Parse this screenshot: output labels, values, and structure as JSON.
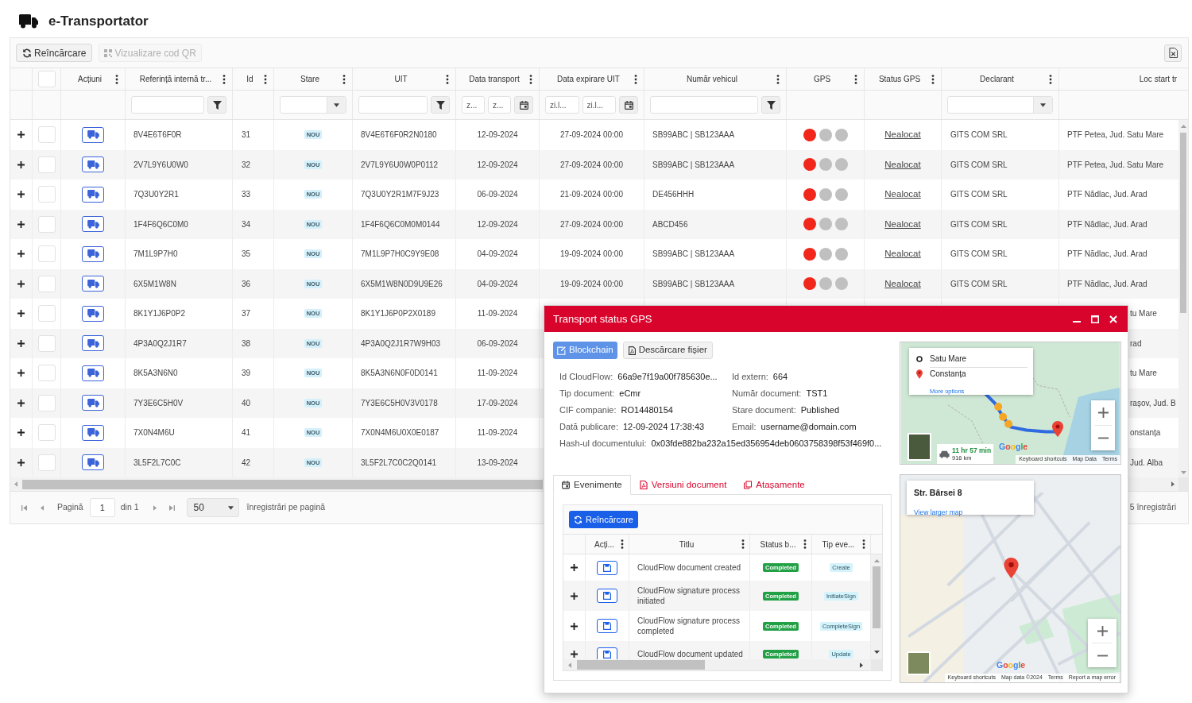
{
  "app": {
    "title": "e-Transportator"
  },
  "toolbar": {
    "buttons": [
      {
        "label": "Reîncărcare",
        "kind": "reload",
        "disabled": false
      },
      {
        "label": "Vizualizare cod QR",
        "kind": "qr",
        "disabled": true
      }
    ]
  },
  "table": {
    "select_all_checked": false,
    "columns": [
      {
        "label": "Acțiuni",
        "menu": true
      },
      {
        "label": "Referință internă tr...",
        "menu": true,
        "filter": {
          "kind": "text"
        }
      },
      {
        "label": "Id",
        "menu": true
      },
      {
        "label": "Stare",
        "menu": true,
        "filter": {
          "kind": "select"
        }
      },
      {
        "label": "UIT",
        "menu": true,
        "filter": {
          "kind": "text"
        }
      },
      {
        "label": "Data transport",
        "menu": true,
        "filter": {
          "kind": "date_range",
          "placeholders": [
            "z...",
            "z..."
          ]
        }
      },
      {
        "label": "Data expirare UIT",
        "menu": true,
        "filter": {
          "kind": "date_range",
          "placeholders": [
            "zi.l...",
            "zi.l..."
          ]
        }
      },
      {
        "label": "Număr vehicul",
        "menu": true,
        "filter": {
          "kind": "text"
        }
      },
      {
        "label": "GPS",
        "menu": true
      },
      {
        "label": "Status GPS",
        "menu": true
      },
      {
        "label": "Declarant",
        "menu": true,
        "filter": {
          "kind": "select"
        }
      },
      {
        "label": "Loc start tr",
        "menu": false
      }
    ],
    "rows": [
      {
        "checked": false,
        "ref": "8V4E6T6F0R",
        "id": "31",
        "stare": "NOU",
        "uit": "8V4E6T6F0R2N0180",
        "data_transport": "12-09-2024",
        "data_expirare": "27-09-2024 00:00",
        "numar_vehicul": "SB99ABC | SB123AAA",
        "gps": [
          {
            "color": "#f2271c"
          },
          {
            "color": "#c0c0c0"
          },
          {
            "color": "#c0c0c0"
          }
        ],
        "status_gps": "Nealocat",
        "declarant": "GITS COM SRL",
        "loc_start": "PTF Petea, Jud. Satu Mare"
      },
      {
        "checked": false,
        "ref": "2V7L9Y6U0W0",
        "id": "32",
        "stare": "NOU",
        "uit": "2V7L9Y6U0W0P0112",
        "data_transport": "12-09-2024",
        "data_expirare": "27-09-2024 00:00",
        "numar_vehicul": "SB99ABC | SB123AAA",
        "gps": [
          {
            "color": "#f2271c"
          },
          {
            "color": "#c0c0c0"
          },
          {
            "color": "#c0c0c0"
          }
        ],
        "status_gps": "Nealocat",
        "declarant": "GITS COM SRL",
        "loc_start": "PTF Petea, Jud. Satu Mare"
      },
      {
        "checked": false,
        "ref": "7Q3U0Y2R1",
        "id": "33",
        "stare": "NOU",
        "uit": "7Q3U0Y2R1M7F9J23",
        "data_transport": "06-09-2024",
        "data_expirare": "21-09-2024 00:00",
        "numar_vehicul": "DE456HHH",
        "gps": [
          {
            "color": "#f2271c"
          },
          {
            "color": "#c0c0c0"
          },
          {
            "color": "#c0c0c0"
          }
        ],
        "status_gps": "Nealocat",
        "declarant": "GITS COM SRL",
        "loc_start": "PTF Nădlac, Jud. Arad"
      },
      {
        "checked": false,
        "ref": "1F4F6Q6C0M0",
        "id": "34",
        "stare": "NOU",
        "uit": "1F4F6Q6C0M0M0144",
        "data_transport": "12-09-2024",
        "data_expirare": "27-09-2024 00:00",
        "numar_vehicul": "ABCD456",
        "gps": [
          {
            "color": "#f2271c"
          },
          {
            "color": "#c0c0c0"
          },
          {
            "color": "#c0c0c0"
          }
        ],
        "status_gps": "Nealocat",
        "declarant": "GITS COM SRL",
        "loc_start": "PTF Nădlac, Jud. Arad"
      },
      {
        "checked": false,
        "ref": "7M1L9P7H0",
        "id": "35",
        "stare": "NOU",
        "uit": "7M1L9P7H0C9Y9E08",
        "data_transport": "04-09-2024",
        "data_expirare": "19-09-2024 00:00",
        "numar_vehicul": "SB99ABC | SB123AAA",
        "gps": [
          {
            "color": "#f2271c"
          },
          {
            "color": "#c0c0c0"
          },
          {
            "color": "#c0c0c0"
          }
        ],
        "status_gps": "Nealocat",
        "declarant": "GITS COM SRL",
        "loc_start": "PTF Nădlac, Jud. Arad"
      },
      {
        "checked": false,
        "ref": "6X5M1W8N",
        "id": "36",
        "stare": "NOU",
        "uit": "6X5M1W8N0D9U9E26",
        "data_transport": "04-09-2024",
        "data_expirare": "19-09-2024 00:00",
        "numar_vehicul": "SB99ABC | SB123AAA",
        "gps": [
          {
            "color": "#f2271c"
          },
          {
            "color": "#c0c0c0"
          },
          {
            "color": "#c0c0c0"
          }
        ],
        "status_gps": "Nealocat",
        "declarant": "GITS COM SRL",
        "loc_start": "PTF Nădlac, Jud. Arad"
      },
      {
        "checked": false,
        "ref": "8K1Y1J6P0P2",
        "id": "37",
        "stare": "NOU",
        "uit": "8K1Y1J6P0P2X0189",
        "data_transport": "11-09-2024",
        "loc_start": "tu Mare"
      },
      {
        "checked": false,
        "ref": "4P3A0Q2J1R7",
        "id": "38",
        "stare": "NOU",
        "uit": "4P3A0Q2J1R7W9H03",
        "data_transport": "06-09-2024",
        "loc_start": "rad"
      },
      {
        "checked": false,
        "ref": "8K5A3N6N0",
        "id": "39",
        "stare": "NOU",
        "uit": "8K5A3N6N0F0D0141",
        "data_transport": "11-09-2024",
        "loc_start": "tu Mare"
      },
      {
        "checked": false,
        "ref": "7Y3E6C5H0V",
        "id": "40",
        "stare": "NOU",
        "uit": "7Y3E6C5H0V3V0178",
        "data_transport": "17-09-2024",
        "loc_start": "rașov, Jud. B"
      },
      {
        "checked": false,
        "ref": "7X0N4M6U",
        "id": "41",
        "stare": "NOU",
        "uit": "7X0N4M6U0X0E0187",
        "data_transport": "11-09-2024",
        "loc_start": "onstanța"
      },
      {
        "checked": false,
        "ref": "3L5F2L7C0C",
        "id": "42",
        "stare": "NOU",
        "uit": "3L5F2L7C0C2Q0141",
        "data_transport": "13-09-2024",
        "loc_start": "Jud. Alba"
      }
    ]
  },
  "pager": {
    "page_label": "Pagină",
    "page": "1",
    "of_label": "din 1",
    "page_size": "50",
    "page_size_label": "înregistrări pe pagină",
    "summary": "5 înregistrări"
  },
  "dialog": {
    "title": "Transport status GPS",
    "buttons": [
      {
        "label": "Blockchain",
        "kind": "primary"
      },
      {
        "label": "Descărcare fișier",
        "kind": "default"
      }
    ],
    "details": [
      [
        {
          "label": "Id CloudFlow:",
          "value": "66a9e7f19a00f785630e..."
        },
        {
          "label": "Id extern:",
          "value": "664"
        }
      ],
      [
        {
          "label": "Tip document:",
          "value": "eCmr"
        },
        {
          "label": "Număr document:",
          "value": "TST1"
        }
      ],
      [
        {
          "label": "CIF companie:",
          "value": "RO14480154"
        },
        {
          "label": "Stare document:",
          "value": "Published"
        }
      ],
      [
        {
          "label": "Dată publicare:",
          "value": "12-09-2024 17:38:43"
        },
        {
          "label": "Email:",
          "value": "username@domain.com"
        }
      ],
      [
        {
          "label": "Hash-ul documentului:",
          "value": "0x03fde882ba232a15ed356954deb0603758398f53f469f0..."
        }
      ]
    ],
    "tabs": [
      {
        "label": "Evenimente",
        "selected": true
      },
      {
        "label": "Versiuni document",
        "selected": false
      },
      {
        "label": "Atașamente",
        "selected": false
      }
    ],
    "events": {
      "reload_label": "Reîncărcare",
      "columns": [
        {
          "label": "Acți..."
        },
        {
          "label": "Titlu"
        },
        {
          "label": "Status b..."
        },
        {
          "label": "Tip eve..."
        }
      ],
      "rows": [
        {
          "title": "CloudFlow document created",
          "status": "Completed",
          "type": "Create"
        },
        {
          "title": "CloudFlow signature process initiated",
          "status": "Completed",
          "type": "InitiateSign"
        },
        {
          "title": "CloudFlow signature process completed",
          "status": "Completed",
          "type": "CompleteSign"
        },
        {
          "title": "CloudFlow document updated",
          "status": "Completed",
          "type": "Update"
        }
      ]
    },
    "route_map": {
      "origin": "Satu Mare",
      "destination": "Constanța",
      "more_options": "More options",
      "duration": "11 hr 57 min",
      "distance": "916 km",
      "logo": "Google",
      "footer": [
        "Keyboard shortcuts",
        "Map Data",
        "Terms"
      ]
    },
    "location_map": {
      "place": "Str. Bârsei 8",
      "link": "View larger map",
      "logo": "Google",
      "footer": [
        "Keyboard shortcuts",
        "Map data ©2024",
        "Terms",
        "Report a map error"
      ]
    }
  }
}
